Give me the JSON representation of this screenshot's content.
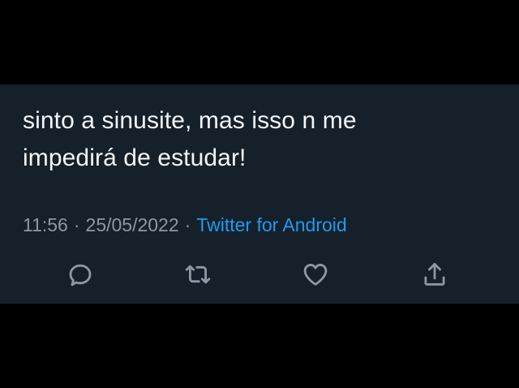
{
  "tweet": {
    "text_lines": [
      "sinto a sinusite, mas isso n me",
      "impedirá de estudar!"
    ],
    "time": "11:56",
    "separator": "·",
    "date": "25/05/2022",
    "source": "Twitter for Android"
  },
  "actions": {
    "reply_icon": "reply-icon",
    "retweet_icon": "retweet-icon",
    "like_icon": "heart-icon",
    "share_icon": "share-icon"
  },
  "colors": {
    "background": "#000000",
    "card": "#16202b",
    "text": "#f4f6f8",
    "muted": "#8b98a5",
    "accent": "#1d9bf0"
  }
}
